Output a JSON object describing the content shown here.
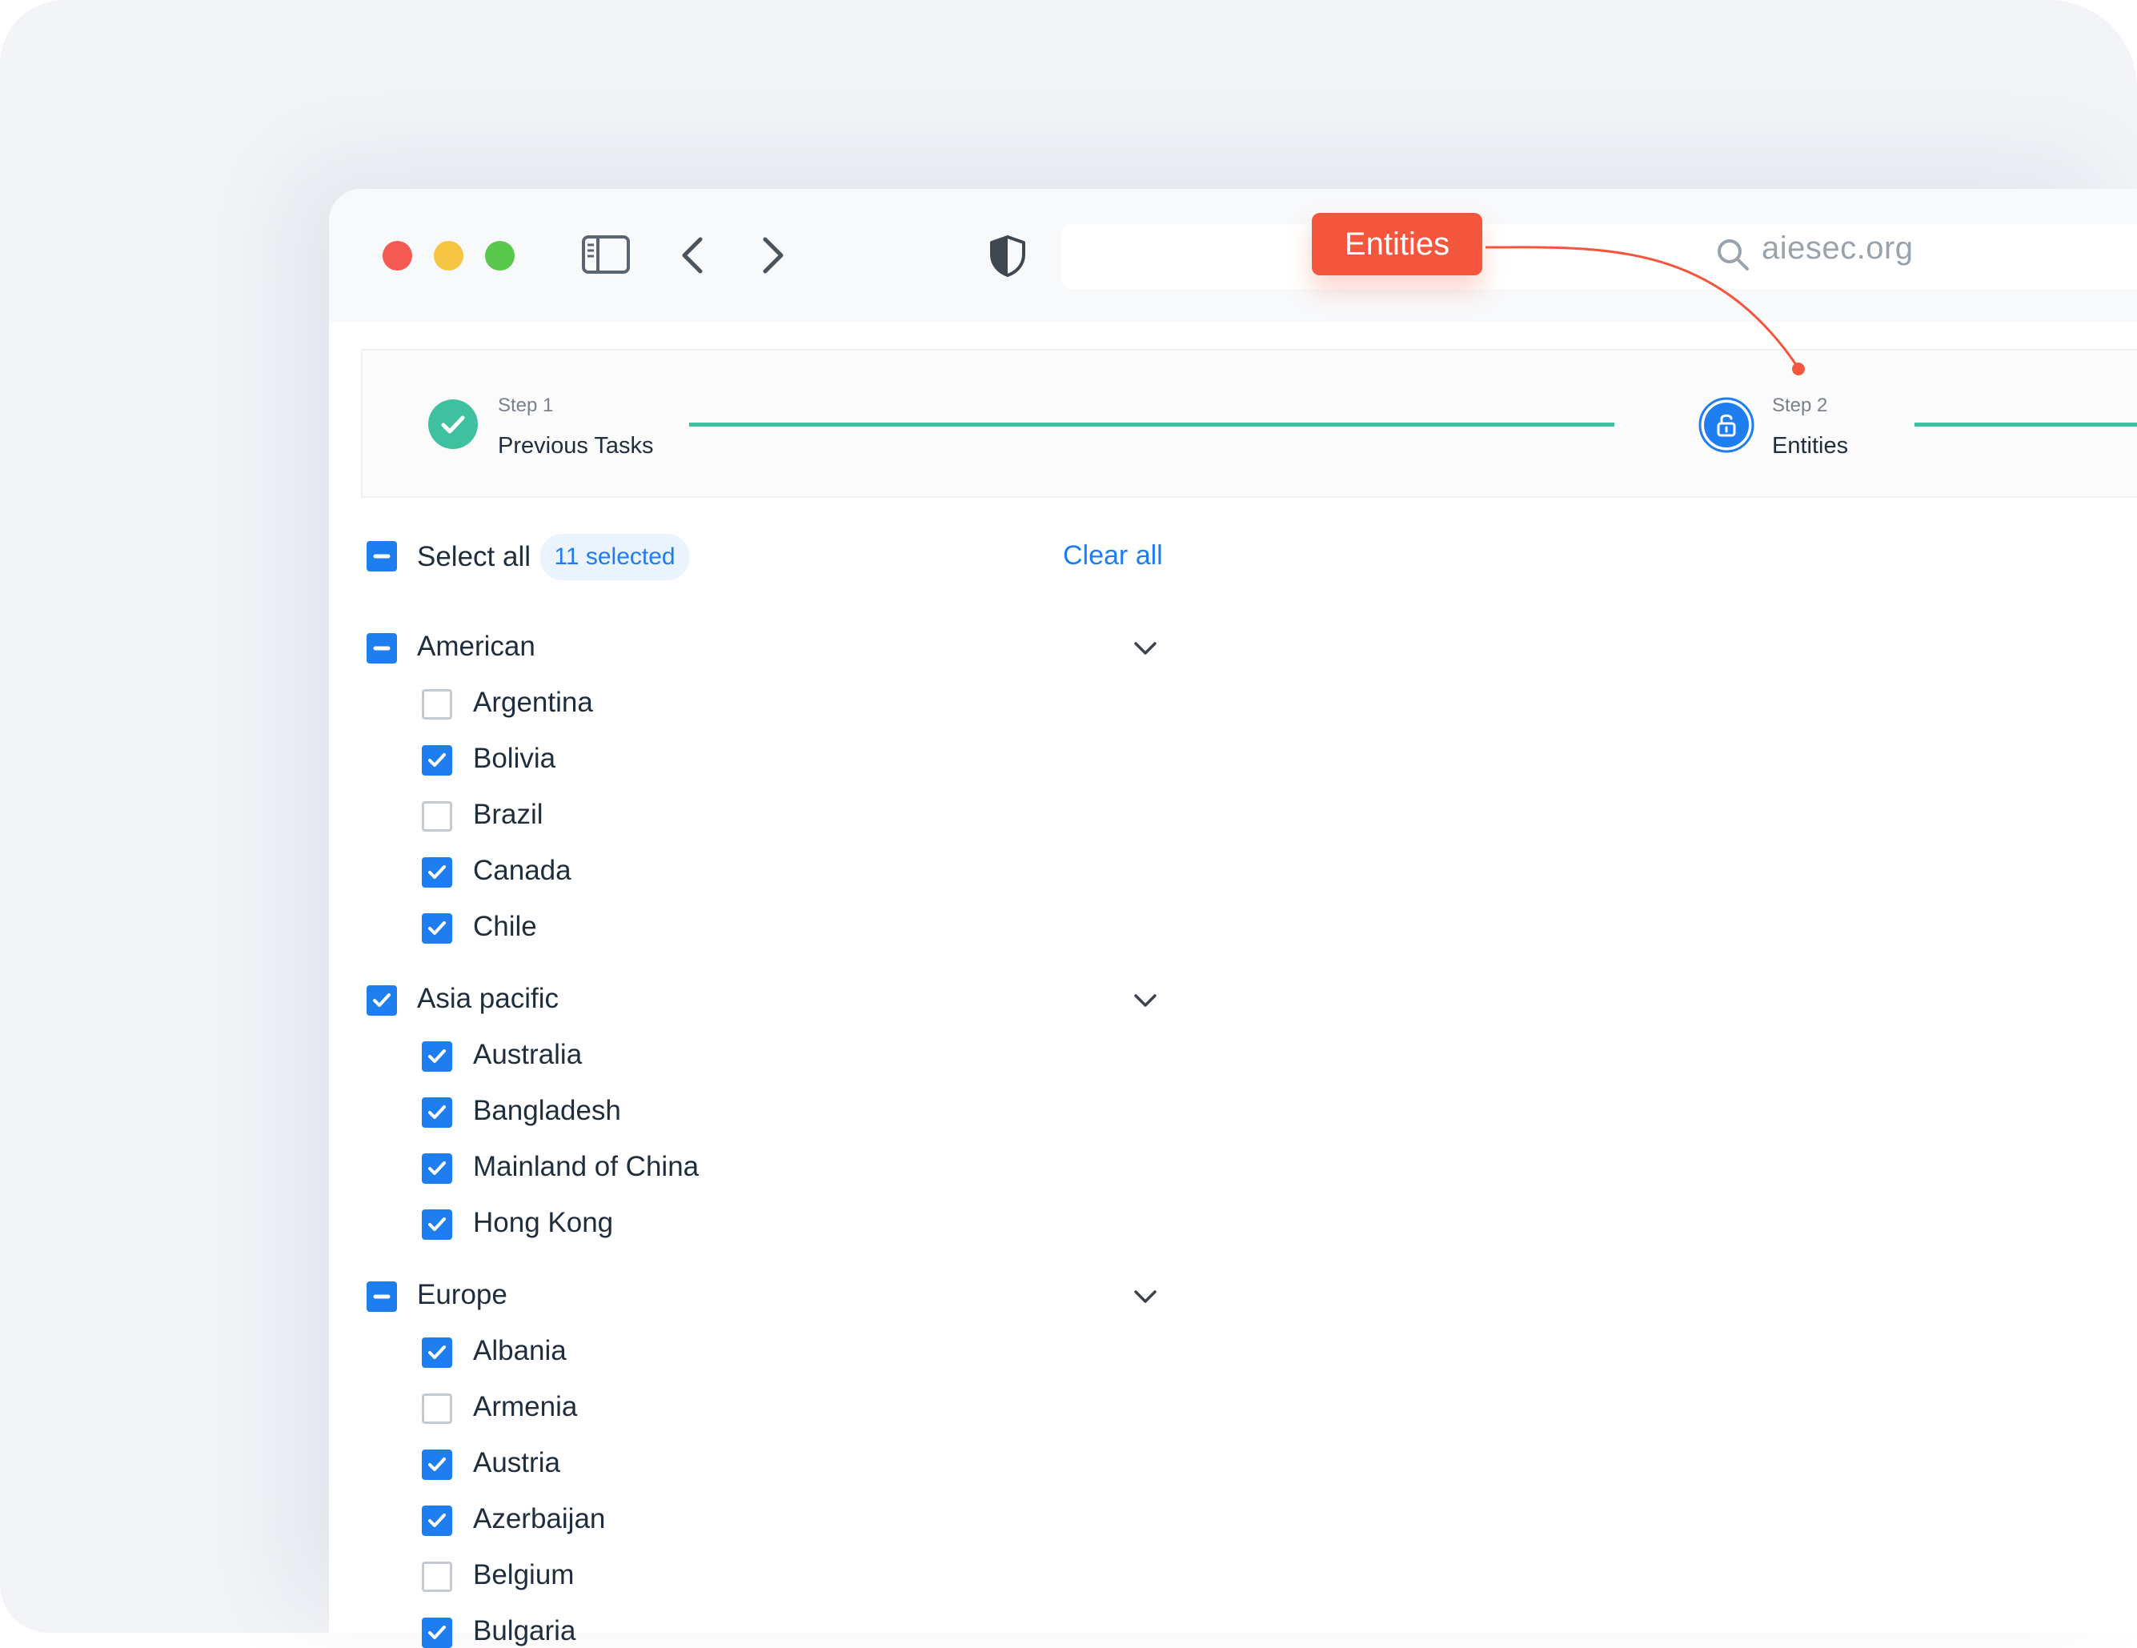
{
  "browser": {
    "url": "aiesec.org",
    "callout_label": "Entities"
  },
  "colors": {
    "accent": "#1e7ef0",
    "success": "#3fc1a0",
    "callout": "#f4563d"
  },
  "stepper": {
    "steps": [
      {
        "label": "Step 1",
        "title": "Previous Tasks",
        "status": "completed"
      },
      {
        "label": "Step 2",
        "title": "Entities",
        "status": "current"
      }
    ]
  },
  "selection": {
    "select_all_label": "Select all",
    "selected_count": "11 selected",
    "clear_all_label": "Clear all"
  },
  "groups": [
    {
      "name": "American",
      "state": "partial",
      "items": [
        {
          "name": "Argentina",
          "checked": false
        },
        {
          "name": "Bolivia",
          "checked": true
        },
        {
          "name": "Brazil",
          "checked": false
        },
        {
          "name": "Canada",
          "checked": true
        },
        {
          "name": "Chile",
          "checked": true
        }
      ]
    },
    {
      "name": "Asia pacific",
      "state": "checked",
      "items": [
        {
          "name": "Australia",
          "checked": true
        },
        {
          "name": "Bangladesh",
          "checked": true
        },
        {
          "name": "Mainland of China",
          "checked": true
        },
        {
          "name": "Hong Kong",
          "checked": true
        }
      ]
    },
    {
      "name": "Europe",
      "state": "partial",
      "items": [
        {
          "name": "Albania",
          "checked": true
        },
        {
          "name": "Armenia",
          "checked": false
        },
        {
          "name": "Austria",
          "checked": true
        },
        {
          "name": "Azerbaijan",
          "checked": true
        },
        {
          "name": "Belgium",
          "checked": false
        },
        {
          "name": "Bulgaria",
          "checked": true
        }
      ]
    }
  ]
}
